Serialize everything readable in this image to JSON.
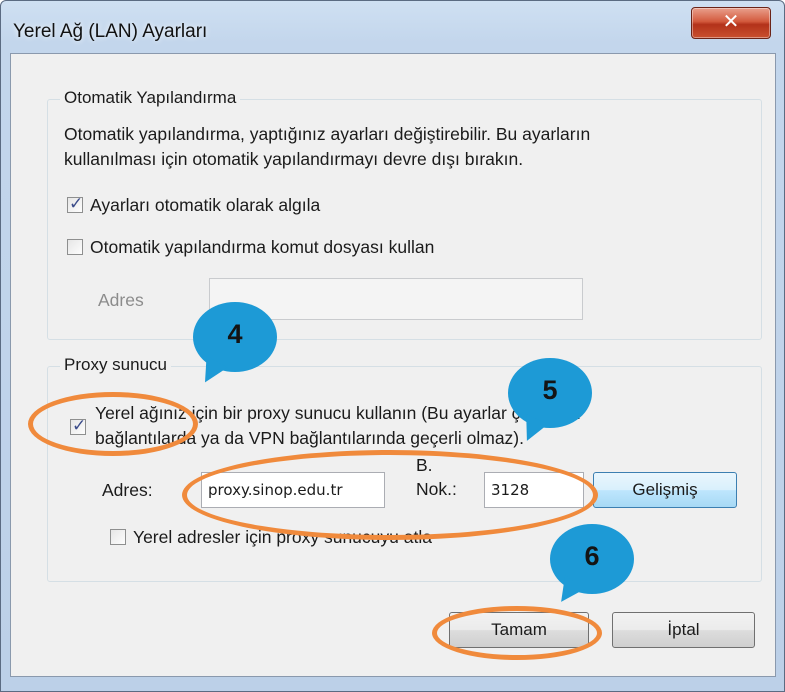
{
  "window": {
    "title": "Yerel Ağ (LAN) Ayarları",
    "close_glyph": "✕"
  },
  "auto_config": {
    "group_title": "Otomatik Yapılandırma",
    "description_line1": "Otomatik yapılandırma, yaptığınız ayarları değiştirebilir. Bu ayarların",
    "description_line2": "kullanılması için otomatik yapılandırmayı devre dışı bırakın.",
    "detect_label": "Ayarları otomatik olarak algıla",
    "detect_checked": true,
    "script_label": "Otomatik yapılandırma komut dosyası kullan",
    "script_checked": false,
    "address_label": "Adres",
    "address_value": ""
  },
  "proxy": {
    "group_title": "Proxy sunucu",
    "use_proxy_label_line1": "Yerel ağınız için bir proxy sunucu kullanın (Bu ayarlar çevirmeli",
    "use_proxy_label_line2": "bağlantılarda ya da VPN bağlantılarında geçerli olmaz).",
    "use_proxy_checked": true,
    "address_label": "Adres:",
    "address_value": "proxy.sinop.edu.tr",
    "port_label_line1": "B.",
    "port_label_line2": "Nok.:",
    "port_value": "3128",
    "advanced_button": "Gelişmiş",
    "bypass_label": "Yerel adresler için proxy sunucuyu atla",
    "bypass_checked": false
  },
  "buttons": {
    "ok": "Tamam",
    "cancel": "İptal"
  },
  "annotations": [
    {
      "number": "4"
    },
    {
      "number": "5"
    },
    {
      "number": "6"
    }
  ],
  "colors": {
    "annotation_blue": "#1d9ad6",
    "annotation_orange": "#f08a3c"
  },
  "checkmark_glyph": "✓"
}
